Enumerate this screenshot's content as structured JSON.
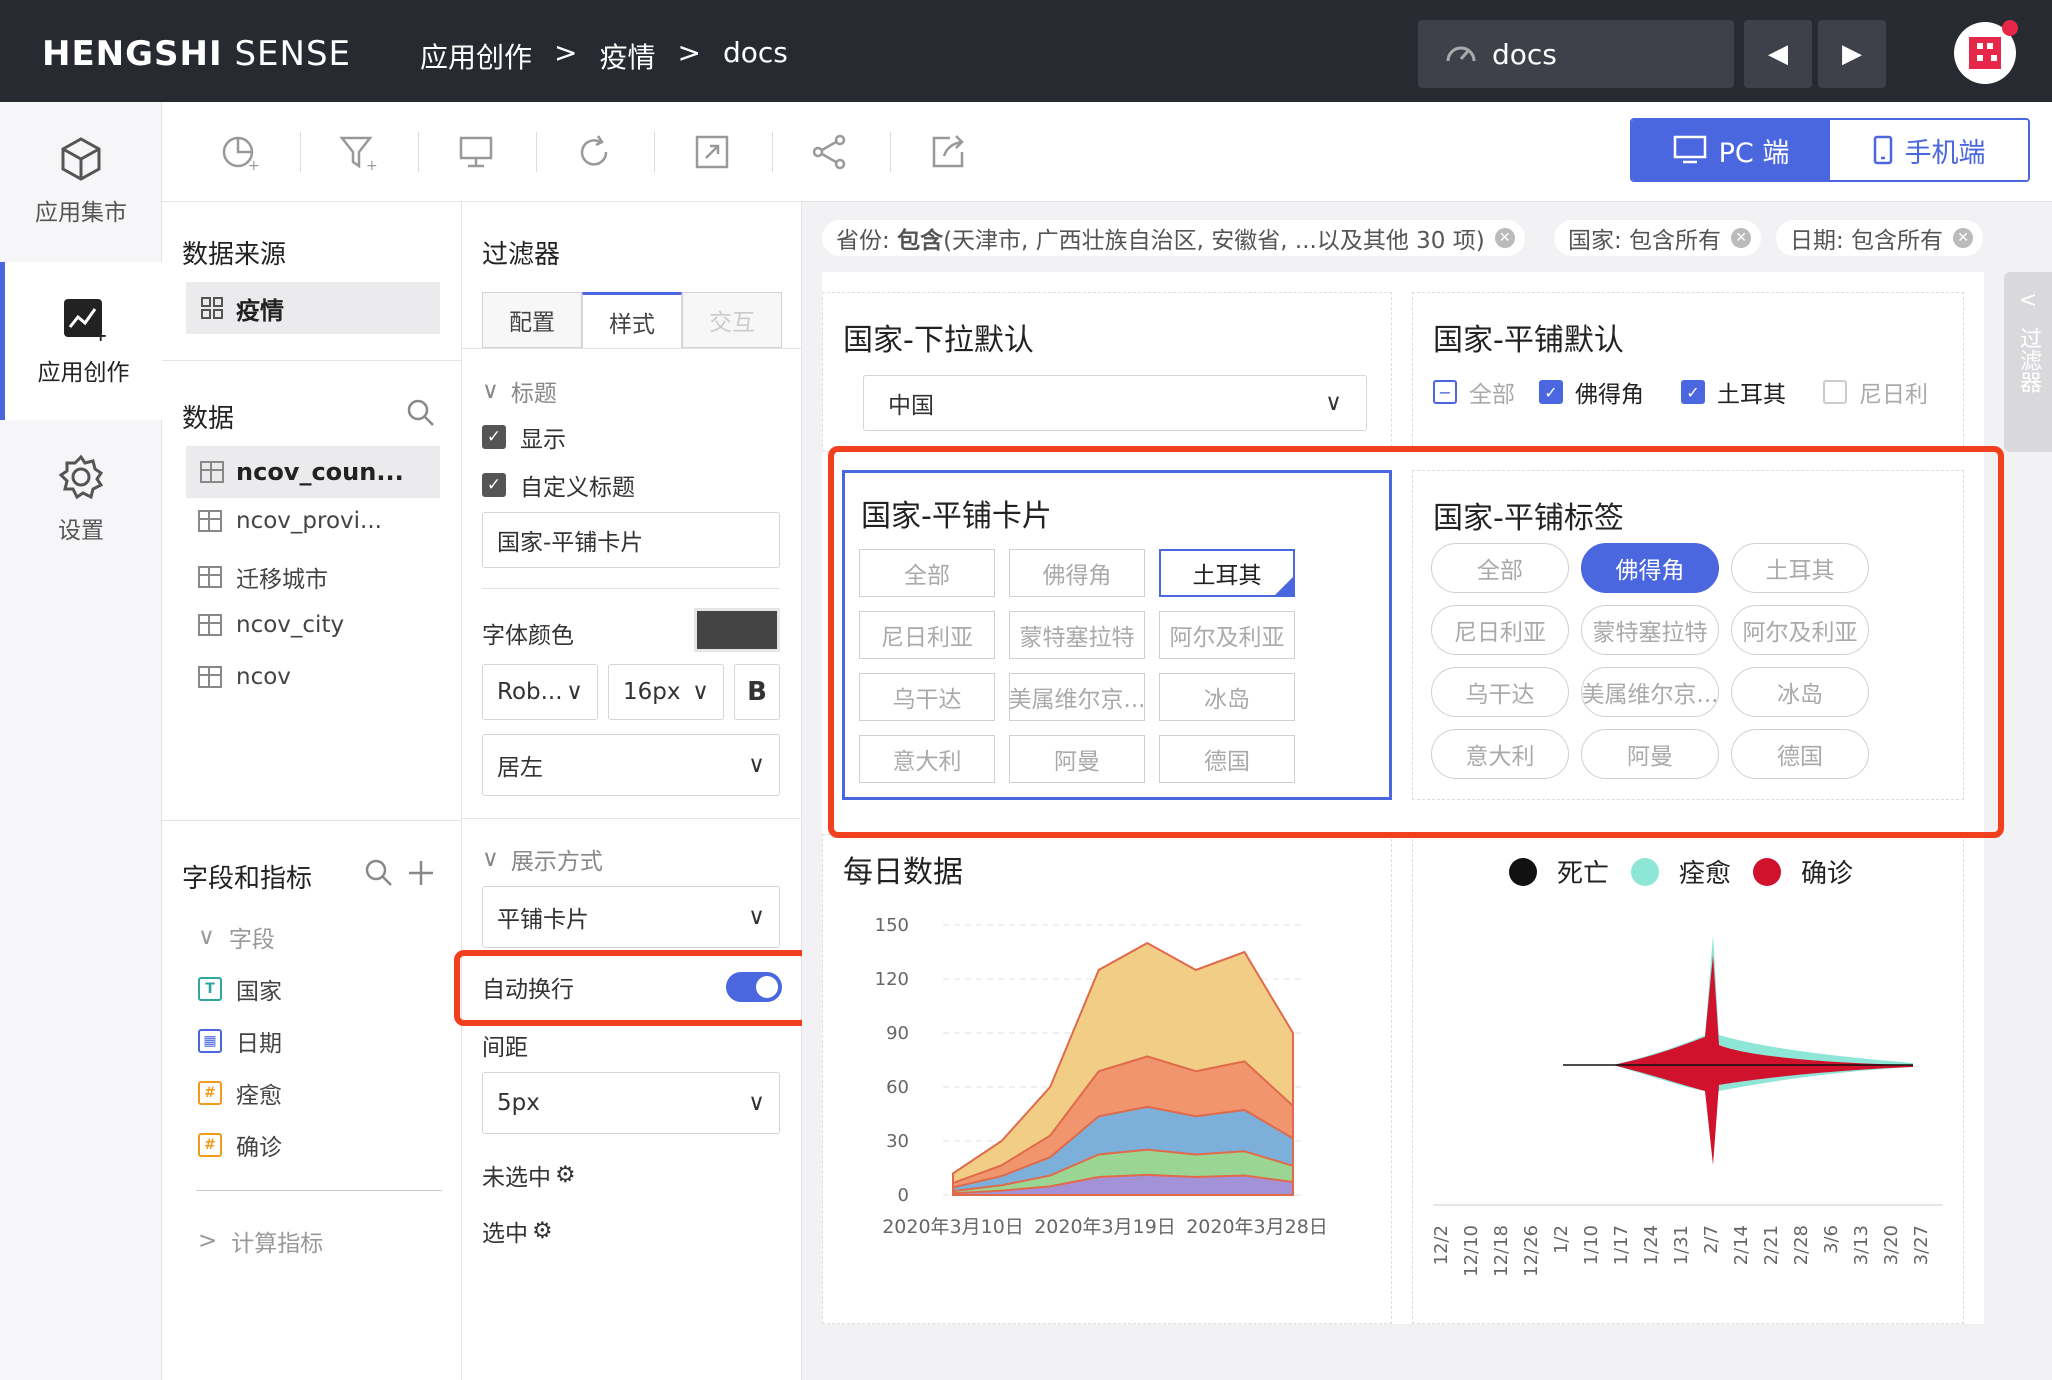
{
  "topbar": {
    "brand_bold": "HENGSHI",
    "brand_light": " SENSE",
    "crumbs": [
      "应用创作",
      ">",
      "疫情",
      ">",
      "docs"
    ],
    "docs_label": "docs"
  },
  "leftnav": {
    "items": [
      {
        "label": "应用集市",
        "icon": "cube-icon"
      },
      {
        "label": "应用创作",
        "icon": "chart-create-icon"
      },
      {
        "label": "设置",
        "icon": "gear-icon"
      }
    ]
  },
  "devices": {
    "pc": "PC 端",
    "mobile": "手机端"
  },
  "datasource": {
    "title": "数据来源",
    "item": "疫情"
  },
  "data": {
    "title": "数据",
    "tables": [
      "ncov_coun...",
      "ncov_provi...",
      "迁移城市",
      "ncov_city",
      "ncov"
    ]
  },
  "fields": {
    "title": "字段和指标",
    "group": "字段",
    "items": [
      {
        "label": "国家",
        "type": "T"
      },
      {
        "label": "日期",
        "type": "date"
      },
      {
        "label": "痊愈",
        "type": "#"
      },
      {
        "label": "确诊",
        "type": "#"
      }
    ],
    "calc": "计算指标"
  },
  "filter_panel": {
    "title": "过滤器",
    "tabs": [
      "配置",
      "样式",
      "交互"
    ],
    "title_section": "标题",
    "show": "显示",
    "custom_title": "自定义标题",
    "title_value": "国家-平铺卡片",
    "font_color": "字体颜色",
    "font_family": "Rob...",
    "font_size": "16px",
    "bold": "B",
    "align": "居左",
    "display_section": "展示方式",
    "display_value": "平铺卡片",
    "auto_wrap": "自动换行",
    "spacing": "间距",
    "spacing_value": "5px",
    "unselected": "未选中",
    "selected": "选中"
  },
  "filter_chips": [
    {
      "label": "省份: ",
      "bold": "包含",
      "rest": "(天津市, 广西壮族自治区, 安徽省, ...以及其他 30 项)"
    },
    {
      "label": "国家: 包含所有"
    },
    {
      "label": "日期: 包含所有"
    }
  ],
  "sidetab": "过滤器",
  "cards": {
    "dropdown": {
      "title": "国家-下拉默认",
      "value": "中国"
    },
    "tile_default": {
      "title": "国家-平铺默认",
      "items": [
        {
          "label": "全部",
          "state": "partial"
        },
        {
          "label": "佛得角",
          "state": "checked"
        },
        {
          "label": "土耳其",
          "state": "checked"
        },
        {
          "label": "尼日利",
          "state": "unchecked"
        }
      ]
    },
    "tile_card": {
      "title": "国家-平铺卡片",
      "items": [
        "全部",
        "佛得角",
        "土耳其",
        "尼日利亚",
        "蒙特塞拉特",
        "阿尔及利亚",
        "乌干达",
        "美属维尔京...",
        "冰岛",
        "意大利",
        "阿曼",
        "德国"
      ],
      "selected": "土耳其"
    },
    "tile_tag": {
      "title": "国家-平铺标签",
      "items": [
        "全部",
        "佛得角",
        "土耳其",
        "尼日利亚",
        "蒙特塞拉特",
        "阿尔及利亚",
        "乌干达",
        "美属维尔京...",
        "冰岛",
        "意大利",
        "阿曼",
        "德国"
      ],
      "selected": "佛得角"
    },
    "daily": {
      "title": "每日数据"
    },
    "stream": {
      "legend": [
        {
          "label": "死亡",
          "color": "#111111"
        },
        {
          "label": "痊愈",
          "color": "#8ee6d6"
        },
        {
          "label": "确诊",
          "color": "#d0122d"
        }
      ]
    }
  },
  "chart_data": [
    {
      "type": "area",
      "title": "每日数据",
      "ylim": [
        0,
        150
      ],
      "yticks": [
        "150",
        "120",
        "90",
        "60",
        "30",
        "0"
      ],
      "xticks": [
        "2020年3月10日",
        "2020年3月19日",
        "2020年3月28日"
      ],
      "x": [
        "3/10",
        "3/13",
        "3/16",
        "3/19",
        "3/22",
        "3/25",
        "3/28",
        "3/30"
      ],
      "series": [
        {
          "values": [
            12,
            30,
            60,
            125,
            140,
            125,
            135,
            90
          ]
        }
      ]
    },
    {
      "type": "area",
      "legend": [
        "死亡",
        "痊愈",
        "确诊"
      ],
      "xticks": [
        "12/2",
        "12/10",
        "12/18",
        "12/26",
        "1/2",
        "1/10",
        "1/17",
        "1/24",
        "1/31",
        "2/7",
        "2/14",
        "2/21",
        "2/28",
        "3/6",
        "3/13",
        "3/20",
        "3/27"
      ]
    }
  ]
}
